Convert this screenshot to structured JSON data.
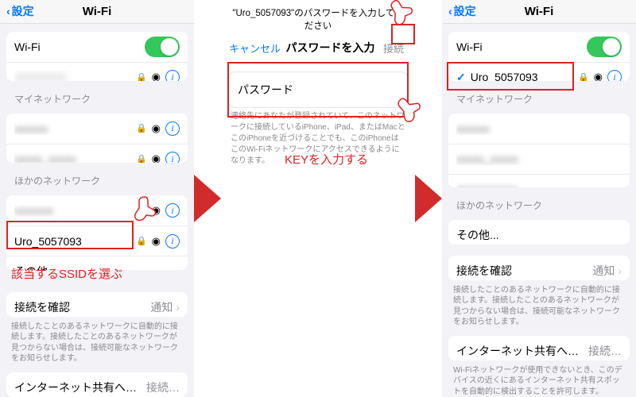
{
  "colors": {
    "accent": "#007aff",
    "annot": "#d22b2b"
  },
  "network_name": "Uro_5057093",
  "left": {
    "back": "設定",
    "title": "Wi-Fi",
    "wifi_label": "Wi-Fi",
    "my_header": "マイネットワーク",
    "other_header": "ほかのネットワーク",
    "other_item": "その他...",
    "ask_label": "接続を確認",
    "ask_value": "通知",
    "ask_note": "接続したことのあるネットワークに自動的に接続します。接続したことのあるネットワークが見つからない場合は、接続可能なネットワークをお知らせします。",
    "hotspot_label": "インターネット共有へ自動接続",
    "hotspot_value": "接続…",
    "my_items": [
      "xxxxxx",
      "xxxxx_xxxxx"
    ],
    "other_items": [
      "xxxxxxx",
      "Uro_5057093"
    ],
    "annot": "該当するSSIDを選ぶ"
  },
  "mid": {
    "prompt": "\"Uro_5057093\"のパスワードを入力してください",
    "cancel": "キャンセル",
    "title": "パスワードを入力",
    "connect": "接続",
    "field": "パスワード",
    "note": "連絡先にあなたが登録されていて、このネットワークに接続しているiPhone、iPad、またはMacとこのiPhoneを近づけることでも、このiPhoneはこのWi-Fiネットワークにアクセスできるようになります。",
    "annot": "KEYを入力する"
  },
  "right": {
    "back": "設定",
    "title": "Wi-Fi",
    "wifi_label": "Wi-Fi",
    "connected": "Uro_5057093",
    "my_header": "マイネットワーク",
    "other_header": "ほかのネットワーク",
    "other_item": "その他...",
    "ask_label": "接続を確認",
    "ask_value": "通知",
    "ask_note": "接続したことのあるネットワークに自動的に接続します。接続したことのあるネットワークが見つからない場合は、接続可能なネットワークをお知らせします。",
    "hotspot_label": "インターネット共有へ自動接続",
    "hotspot_value": "接続…",
    "hotspot_note": "Wi-Fiネットワークが使用できないとき、このデバイスの近くにあるインターネット共有スポットを自動的に検出することを許可します。",
    "my_items": [
      "xxxxxx",
      "xxxxx_xxxxx",
      "xxxxxxxxxxx"
    ]
  }
}
